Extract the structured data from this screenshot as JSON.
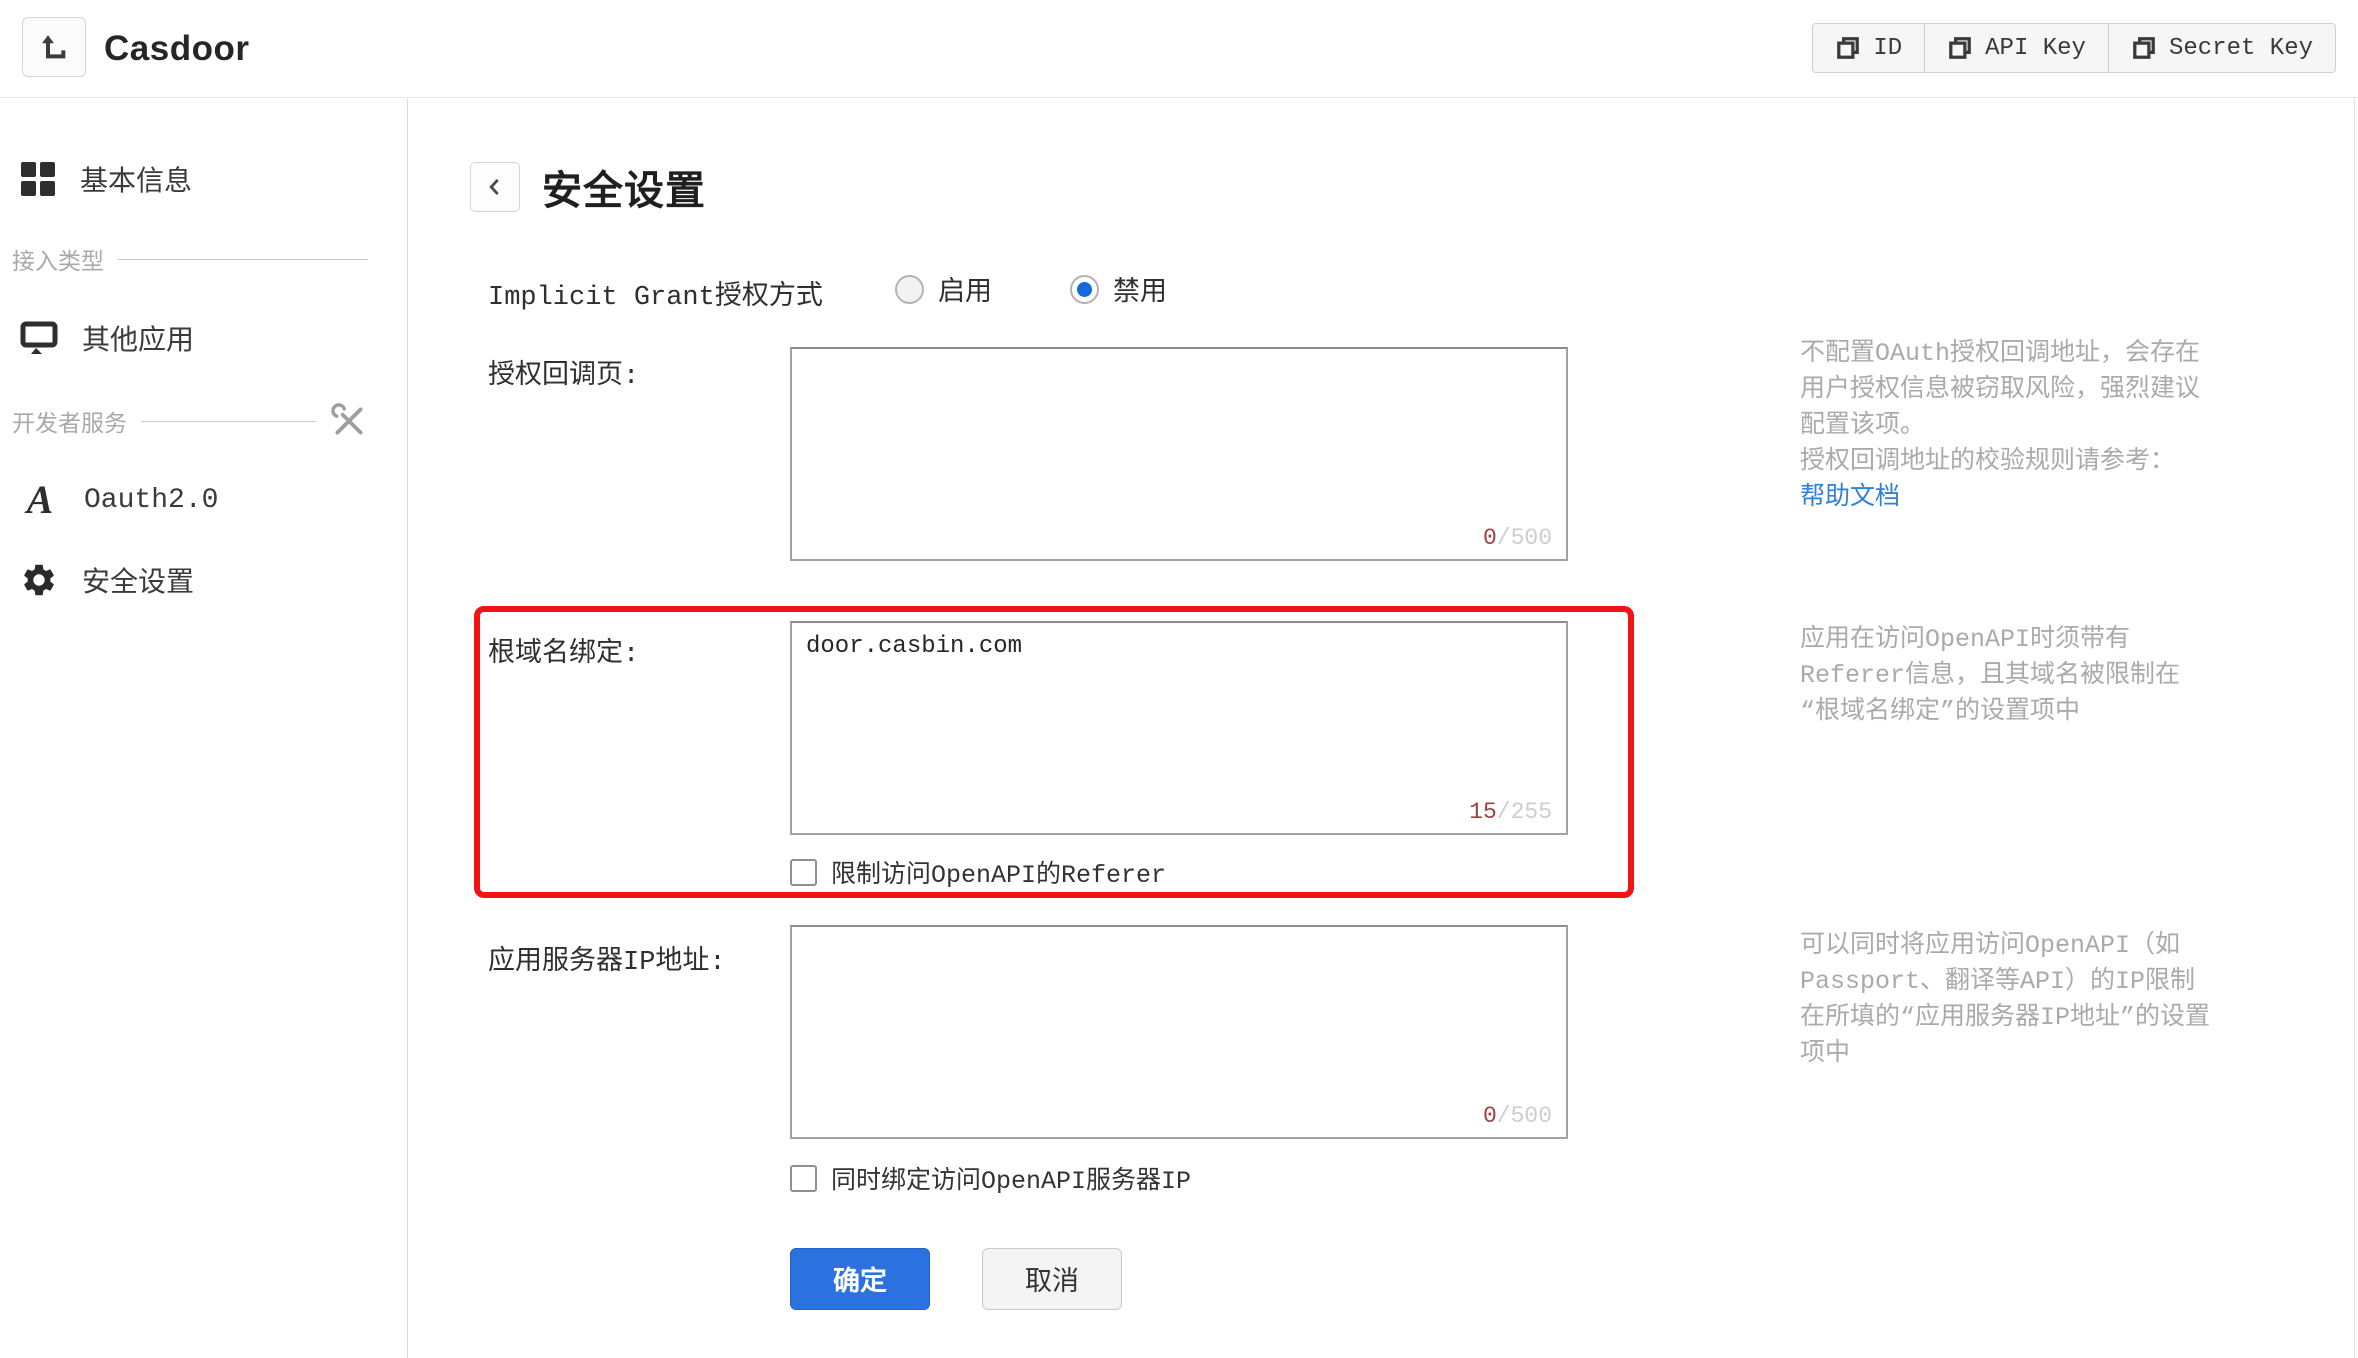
{
  "header": {
    "app_title": "Casdoor",
    "copy_buttons": [
      {
        "label": "ID"
      },
      {
        "label": "API Key"
      },
      {
        "label": "Secret Key"
      }
    ]
  },
  "sidebar": {
    "items": [
      {
        "label": "基本信息",
        "icon": "grid-icon"
      },
      {
        "label": "接入类型",
        "type": "group"
      },
      {
        "label": "其他应用",
        "icon": "monitor-icon"
      },
      {
        "label": "开发者服务",
        "type": "group",
        "icon": "tools-icon"
      },
      {
        "label": "Oauth2.0",
        "icon": "api-icon"
      },
      {
        "label": "安全设置",
        "icon": "gear-icon"
      }
    ]
  },
  "page": {
    "title": "安全设置",
    "implicit": {
      "label": "Implicit Grant授权方式",
      "options": [
        {
          "label": "启用",
          "selected": false
        },
        {
          "label": "禁用",
          "selected": true
        }
      ]
    },
    "callback": {
      "label": "授权回调页:",
      "value": "",
      "used": "0",
      "max": "/500",
      "help_line1": "不配置OAuth授权回调地址，会存在用户授权信息被窃取风险，强烈建议配置该项。",
      "help_line2": "授权回调地址的校验规则请参考：",
      "help_link": "帮助文档"
    },
    "domain": {
      "label": "根域名绑定:",
      "value": "door.casbin.com",
      "used": "15",
      "max": "/255",
      "checkbox_label": "限制访问OpenAPI的Referer",
      "checked": false,
      "help_text": "应用在访问OpenAPI时须带有Referer信息，且其域名被限制在 “根域名绑定”的设置项中"
    },
    "server_ip": {
      "label": "应用服务器IP地址:",
      "value": "",
      "used": "0",
      "max": "/500",
      "checkbox_label": "同时绑定访问OpenAPI服务器IP",
      "checked": false,
      "help_text": "可以同时将应用访问OpenAPI（如Passport、翻译等API）的IP限制在所填的“应用服务器IP地址”的设置项中"
    },
    "buttons": {
      "ok": "确定",
      "cancel": "取消"
    }
  },
  "colors": {
    "accent_blue": "#2b72e0",
    "link_blue": "#2f80d9",
    "highlight_red": "#f01414",
    "counter_used": "#a23f3f",
    "counter_max": "#cdcdcd"
  }
}
